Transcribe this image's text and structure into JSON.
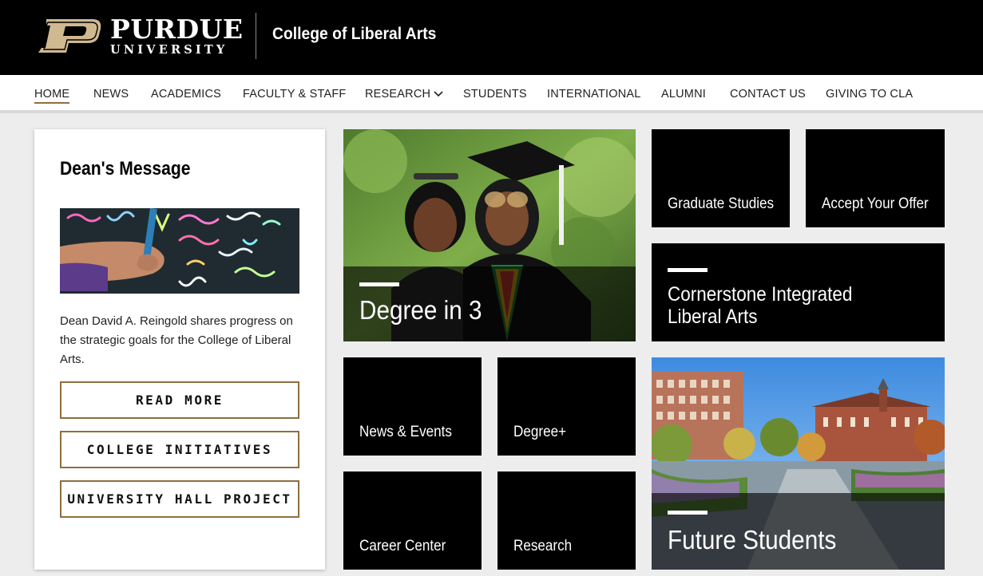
{
  "header": {
    "university_name": "PURDUE",
    "university_sub": "UNIVERSITY",
    "college_title": "College of Liberal Arts"
  },
  "nav": {
    "items": [
      {
        "label": "HOME",
        "active": true
      },
      {
        "label": "NEWS"
      },
      {
        "label": "ACADEMICS"
      },
      {
        "label": "FACULTY & STAFF"
      },
      {
        "label": "RESEARCH",
        "has_dropdown": true
      },
      {
        "label": "STUDENTS"
      },
      {
        "label": "INTERNATIONAL"
      },
      {
        "label": "ALUMNI"
      },
      {
        "label": "CONTACT US"
      },
      {
        "label": "GIVING TO CLA"
      }
    ]
  },
  "dean": {
    "title": "Dean's Message",
    "body": "Dean David A. Reingold shares progress on the strategic goals for the College of Liberal Arts.",
    "buttons": [
      "READ MORE",
      "COLLEGE INITIATIVES",
      "UNIVERSITY HALL PROJECT"
    ]
  },
  "tiles": {
    "degree_in_3": "Degree in 3",
    "graduate_studies": "Graduate Studies",
    "accept_offer": "Accept Your Offer",
    "cornerstone": "Cornerstone Integrated Liberal Arts",
    "news_events": "News & Events",
    "degree_plus": "Degree+",
    "career_center": "Career Center",
    "research": "Research",
    "future_students": "Future Students"
  },
  "colors": {
    "gold": "#8e6f3e",
    "black": "#000000",
    "background": "#ededed"
  }
}
